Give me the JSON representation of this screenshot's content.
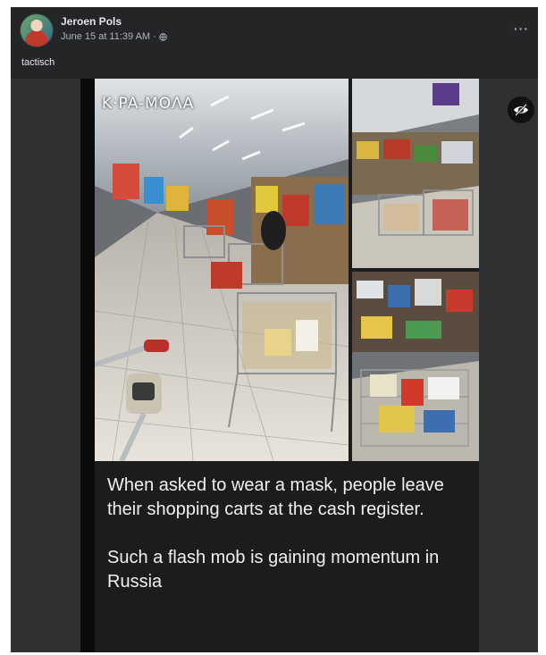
{
  "post": {
    "author": "Jeroen Pols",
    "timestamp": "June 15 at 11:39 AM",
    "separator": "·",
    "privacy_icon": "globe-icon",
    "more_label": "···",
    "caption": "tactisch"
  },
  "image": {
    "brand_tag": "K·PA-MOΛA",
    "text_lines": [
      "When asked to wear a mask, people leave their shopping carts at the cash register.",
      "Such a flash mob is gaining momentum in Russia"
    ],
    "hide_icon": "eye-slash-icon"
  },
  "colors": {
    "card_bg": "#242526",
    "text_primary": "#e4e6eb",
    "text_secondary": "#b0b3b8"
  }
}
